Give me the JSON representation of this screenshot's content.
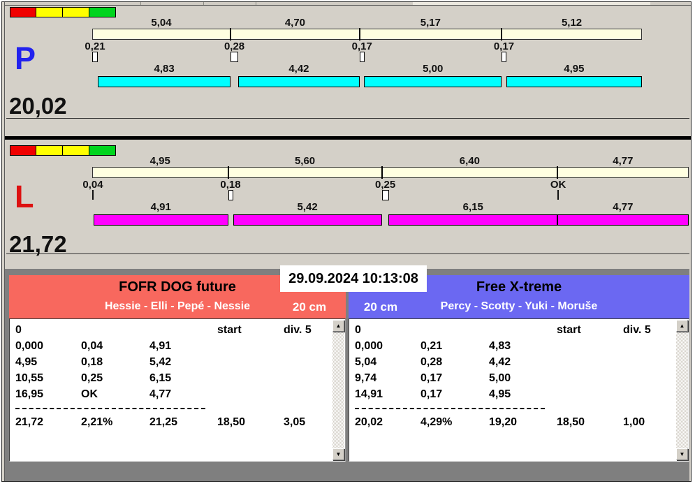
{
  "window": {
    "title": ""
  },
  "colors": {
    "window_bg": "#D4D0C8",
    "run_bar": "#FFFFE1",
    "lane_p_bar": "#00FFFF",
    "lane_l_bar": "#FF00FF",
    "indicator": [
      "#F00000",
      "#FFFF00",
      "#FFFF00",
      "#00D41E"
    ],
    "lane_p_letter": "#2222EE",
    "lane_l_letter": "#DD1111",
    "team_left_header": "#F8685E",
    "team_right_header": "#6B68F2",
    "bottom_backdrop": "#7F7F7F"
  },
  "lanes": [
    {
      "id": "P",
      "letter": "P",
      "letter_color": "#2222EE",
      "total": "20,02",
      "bar_color": "#00FFFF",
      "indicator_colors": [
        "#F00000",
        "#FFFF00",
        "#FFFF00",
        "#00D41E"
      ],
      "segments": [
        {
          "run_label": "5,04",
          "run_s": 5.04,
          "change_label": "0,21",
          "change_s": 0.21,
          "marker": "box",
          "split_label": "4,83",
          "split_s": 4.83
        },
        {
          "run_label": "4,70",
          "run_s": 4.7,
          "change_label": "0,28",
          "change_s": 0.28,
          "marker": "box",
          "split_label": "4,42",
          "split_s": 4.42
        },
        {
          "run_label": "5,17",
          "run_s": 5.17,
          "change_label": "0,17",
          "change_s": 0.17,
          "marker": "box",
          "split_label": "5,00",
          "split_s": 5.0
        },
        {
          "run_label": "5,12",
          "run_s": 5.12,
          "change_label": "0,17",
          "change_s": 0.17,
          "marker": "box",
          "split_label": "4,95",
          "split_s": 4.95
        }
      ]
    },
    {
      "id": "L",
      "letter": "L",
      "letter_color": "#DD1111",
      "total": "21,72",
      "bar_color": "#FF00FF",
      "indicator_colors": [
        "#F00000",
        "#FFFF00",
        "#FFFF00",
        "#00D41E"
      ],
      "segments": [
        {
          "run_label": "4,95",
          "run_s": 4.95,
          "change_label": "0,04",
          "change_s": 0.04,
          "marker": "line",
          "split_label": "4,91",
          "split_s": 4.91
        },
        {
          "run_label": "5,60",
          "run_s": 5.6,
          "change_label": "0,18",
          "change_s": 0.18,
          "marker": "box",
          "split_label": "5,42",
          "split_s": 5.42
        },
        {
          "run_label": "6,40",
          "run_s": 6.4,
          "change_label": "0,25",
          "change_s": 0.25,
          "marker": "box",
          "split_label": "6,15",
          "split_s": 6.15
        },
        {
          "run_label": "4,77",
          "run_s": 4.77,
          "change_label": "OK",
          "change_s": 0,
          "marker": "line",
          "split_label": "4,77",
          "split_s": 4.77
        }
      ]
    }
  ],
  "footer": {
    "datetime": "29.09.2024 10:13:08",
    "teams": [
      {
        "name": "FOFR DOG future",
        "dogs": "Hessie - Elli - Pepé - Nessie",
        "size": "20 cm",
        "header_color": "#F8685E",
        "header_row": [
          "0",
          "",
          "",
          "start",
          "div. 5"
        ],
        "rows": [
          [
            "0,000",
            "0,04",
            "4,91",
            "",
            ""
          ],
          [
            "4,95",
            "0,18",
            "5,42",
            "",
            ""
          ],
          [
            "10,55",
            "0,25",
            "6,15",
            "",
            ""
          ],
          [
            "16,95",
            "OK",
            "4,77",
            "",
            ""
          ]
        ],
        "totals": [
          "21,72",
          "2,21%",
          "21,25",
          "18,50",
          "3,05"
        ]
      },
      {
        "name": "Free X-treme",
        "dogs": "Percy - Scotty - Yuki - Moruše",
        "size": "20 cm",
        "header_color": "#6B68F2",
        "header_row": [
          "0",
          "",
          "",
          "start",
          "div. 5"
        ],
        "rows": [
          [
            "0,000",
            "0,21",
            "4,83",
            "",
            ""
          ],
          [
            "5,04",
            "0,28",
            "4,42",
            "",
            ""
          ],
          [
            "9,74",
            "0,17",
            "5,00",
            "",
            ""
          ],
          [
            "14,91",
            "0,17",
            "4,95",
            "",
            ""
          ]
        ],
        "totals": [
          "20,02",
          "4,29%",
          "19,20",
          "18,50",
          "1,00"
        ]
      }
    ],
    "scrollbar": {
      "up_glyph": "▲",
      "down_glyph": "▼"
    }
  }
}
